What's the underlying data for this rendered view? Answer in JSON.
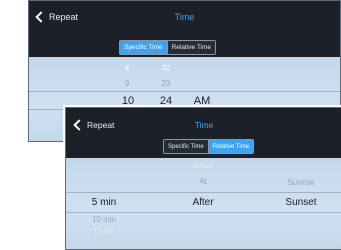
{
  "screen_specific": {
    "back_label": "Repeat",
    "title": "Time",
    "segment": {
      "specific_label": "Specific Time",
      "relative_label": "Relative Time",
      "selected": "Specific Time"
    },
    "picker": {
      "hour_items": [
        "8",
        "9",
        "10"
      ],
      "minute_items": [
        "22",
        "23",
        "24"
      ],
      "ampm_selected": "AM",
      "hour_selected": "10",
      "minute_selected": "24"
    }
  },
  "screen_relative": {
    "back_label": "Repeat",
    "title": "Time",
    "segment": {
      "specific_label": "Specific Time",
      "relative_label": "Relative Time",
      "selected": "Relative Time"
    },
    "picker": {
      "offset_items": [
        "5 min",
        "10 min",
        "15 min"
      ],
      "relation_items": [
        "Before",
        "At",
        "After"
      ],
      "event_items": [
        "Sunrise",
        "Sunset"
      ],
      "offset_selected": "5 min",
      "relation_selected": "After",
      "event_selected": "Sunset"
    }
  },
  "colors": {
    "header_bg": "#1b2029",
    "accent": "#3ea3f5",
    "picker_bg": "#c9dcef"
  },
  "icons": {
    "back": "chevron-left-icon"
  }
}
